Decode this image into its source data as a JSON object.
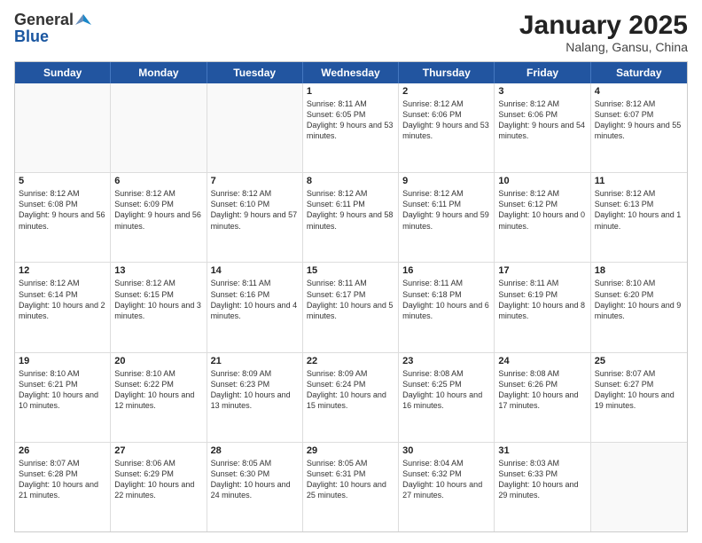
{
  "logo": {
    "line1": "General",
    "line2": "Blue"
  },
  "header": {
    "month": "January 2025",
    "location": "Nalang, Gansu, China"
  },
  "weekdays": [
    "Sunday",
    "Monday",
    "Tuesday",
    "Wednesday",
    "Thursday",
    "Friday",
    "Saturday"
  ],
  "weeks": [
    [
      {
        "day": "",
        "info": ""
      },
      {
        "day": "",
        "info": ""
      },
      {
        "day": "",
        "info": ""
      },
      {
        "day": "1",
        "info": "Sunrise: 8:11 AM\nSunset: 6:05 PM\nDaylight: 9 hours and 53 minutes."
      },
      {
        "day": "2",
        "info": "Sunrise: 8:12 AM\nSunset: 6:06 PM\nDaylight: 9 hours and 53 minutes."
      },
      {
        "day": "3",
        "info": "Sunrise: 8:12 AM\nSunset: 6:06 PM\nDaylight: 9 hours and 54 minutes."
      },
      {
        "day": "4",
        "info": "Sunrise: 8:12 AM\nSunset: 6:07 PM\nDaylight: 9 hours and 55 minutes."
      }
    ],
    [
      {
        "day": "5",
        "info": "Sunrise: 8:12 AM\nSunset: 6:08 PM\nDaylight: 9 hours and 56 minutes."
      },
      {
        "day": "6",
        "info": "Sunrise: 8:12 AM\nSunset: 6:09 PM\nDaylight: 9 hours and 56 minutes."
      },
      {
        "day": "7",
        "info": "Sunrise: 8:12 AM\nSunset: 6:10 PM\nDaylight: 9 hours and 57 minutes."
      },
      {
        "day": "8",
        "info": "Sunrise: 8:12 AM\nSunset: 6:11 PM\nDaylight: 9 hours and 58 minutes."
      },
      {
        "day": "9",
        "info": "Sunrise: 8:12 AM\nSunset: 6:11 PM\nDaylight: 9 hours and 59 minutes."
      },
      {
        "day": "10",
        "info": "Sunrise: 8:12 AM\nSunset: 6:12 PM\nDaylight: 10 hours and 0 minutes."
      },
      {
        "day": "11",
        "info": "Sunrise: 8:12 AM\nSunset: 6:13 PM\nDaylight: 10 hours and 1 minute."
      }
    ],
    [
      {
        "day": "12",
        "info": "Sunrise: 8:12 AM\nSunset: 6:14 PM\nDaylight: 10 hours and 2 minutes."
      },
      {
        "day": "13",
        "info": "Sunrise: 8:12 AM\nSunset: 6:15 PM\nDaylight: 10 hours and 3 minutes."
      },
      {
        "day": "14",
        "info": "Sunrise: 8:11 AM\nSunset: 6:16 PM\nDaylight: 10 hours and 4 minutes."
      },
      {
        "day": "15",
        "info": "Sunrise: 8:11 AM\nSunset: 6:17 PM\nDaylight: 10 hours and 5 minutes."
      },
      {
        "day": "16",
        "info": "Sunrise: 8:11 AM\nSunset: 6:18 PM\nDaylight: 10 hours and 6 minutes."
      },
      {
        "day": "17",
        "info": "Sunrise: 8:11 AM\nSunset: 6:19 PM\nDaylight: 10 hours and 8 minutes."
      },
      {
        "day": "18",
        "info": "Sunrise: 8:10 AM\nSunset: 6:20 PM\nDaylight: 10 hours and 9 minutes."
      }
    ],
    [
      {
        "day": "19",
        "info": "Sunrise: 8:10 AM\nSunset: 6:21 PM\nDaylight: 10 hours and 10 minutes."
      },
      {
        "day": "20",
        "info": "Sunrise: 8:10 AM\nSunset: 6:22 PM\nDaylight: 10 hours and 12 minutes."
      },
      {
        "day": "21",
        "info": "Sunrise: 8:09 AM\nSunset: 6:23 PM\nDaylight: 10 hours and 13 minutes."
      },
      {
        "day": "22",
        "info": "Sunrise: 8:09 AM\nSunset: 6:24 PM\nDaylight: 10 hours and 15 minutes."
      },
      {
        "day": "23",
        "info": "Sunrise: 8:08 AM\nSunset: 6:25 PM\nDaylight: 10 hours and 16 minutes."
      },
      {
        "day": "24",
        "info": "Sunrise: 8:08 AM\nSunset: 6:26 PM\nDaylight: 10 hours and 17 minutes."
      },
      {
        "day": "25",
        "info": "Sunrise: 8:07 AM\nSunset: 6:27 PM\nDaylight: 10 hours and 19 minutes."
      }
    ],
    [
      {
        "day": "26",
        "info": "Sunrise: 8:07 AM\nSunset: 6:28 PM\nDaylight: 10 hours and 21 minutes."
      },
      {
        "day": "27",
        "info": "Sunrise: 8:06 AM\nSunset: 6:29 PM\nDaylight: 10 hours and 22 minutes."
      },
      {
        "day": "28",
        "info": "Sunrise: 8:05 AM\nSunset: 6:30 PM\nDaylight: 10 hours and 24 minutes."
      },
      {
        "day": "29",
        "info": "Sunrise: 8:05 AM\nSunset: 6:31 PM\nDaylight: 10 hours and 25 minutes."
      },
      {
        "day": "30",
        "info": "Sunrise: 8:04 AM\nSunset: 6:32 PM\nDaylight: 10 hours and 27 minutes."
      },
      {
        "day": "31",
        "info": "Sunrise: 8:03 AM\nSunset: 6:33 PM\nDaylight: 10 hours and 29 minutes."
      },
      {
        "day": "",
        "info": ""
      }
    ]
  ]
}
